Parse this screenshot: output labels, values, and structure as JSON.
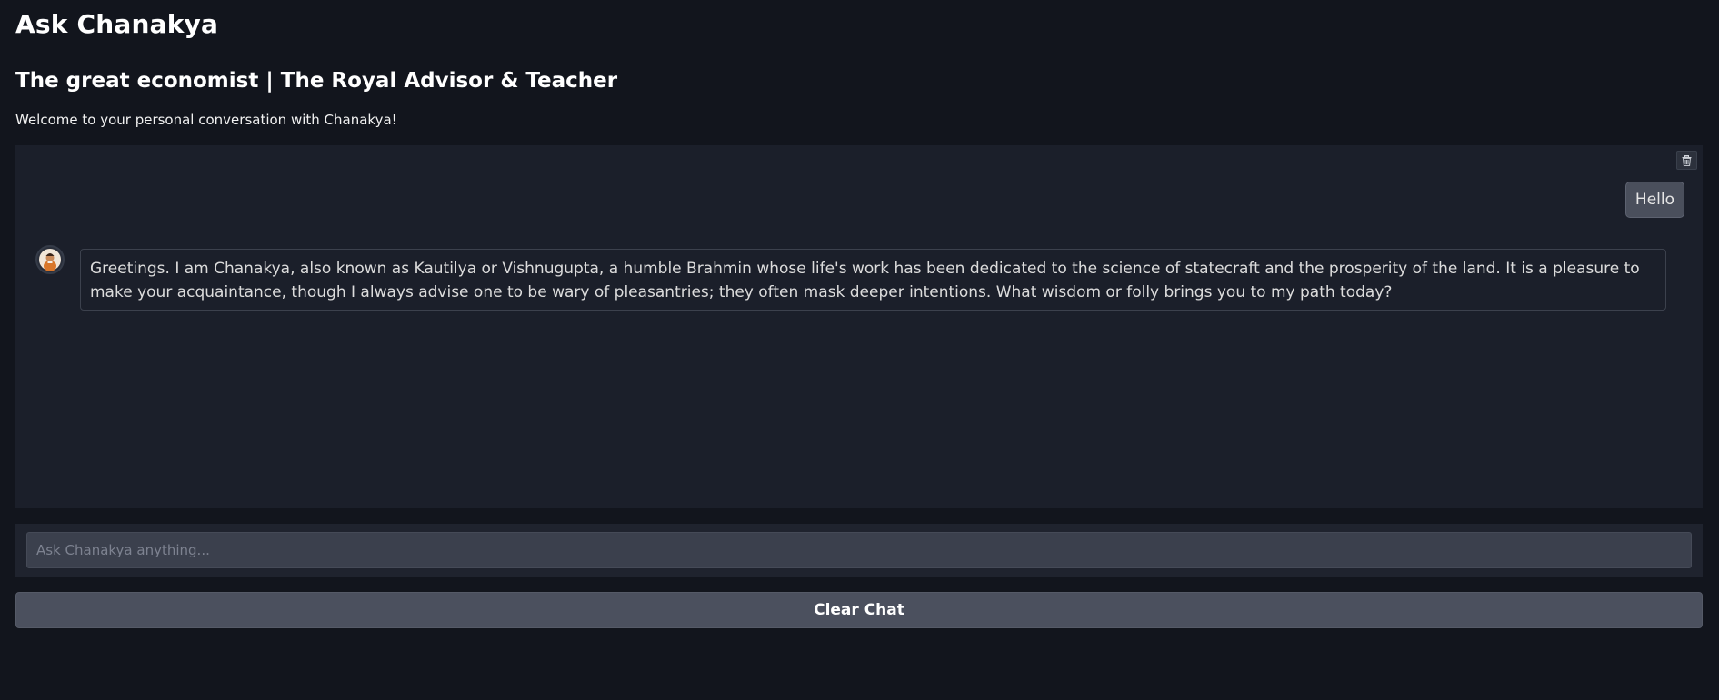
{
  "header": {
    "title": "Ask Chanakya",
    "subtitle": "The great economist | The Royal Advisor & Teacher",
    "welcome": "Welcome to your personal conversation with Chanakya!"
  },
  "chat": {
    "clear_icon": "trash-icon",
    "messages": [
      {
        "role": "user",
        "text": "Hello"
      },
      {
        "role": "assistant",
        "avatar": "chanakya-avatar",
        "text": "Greetings. I am Chanakya, also known as Kautilya or Vishnugupta, a humble Brahmin whose life's work has been dedicated to the science of statecraft and the prosperity of the land. It is a pleasure to make your acquaintance, though I always advise one to be wary of pleasantries; they often mask deeper intentions. What wisdom or folly brings you to my path today?"
      }
    ]
  },
  "input": {
    "placeholder": "Ask Chanakya anything...",
    "value": ""
  },
  "actions": {
    "clear_label": "Clear Chat"
  },
  "colors": {
    "background": "#12151d",
    "panel": "#1b1f2a",
    "button": "#4b505e"
  }
}
